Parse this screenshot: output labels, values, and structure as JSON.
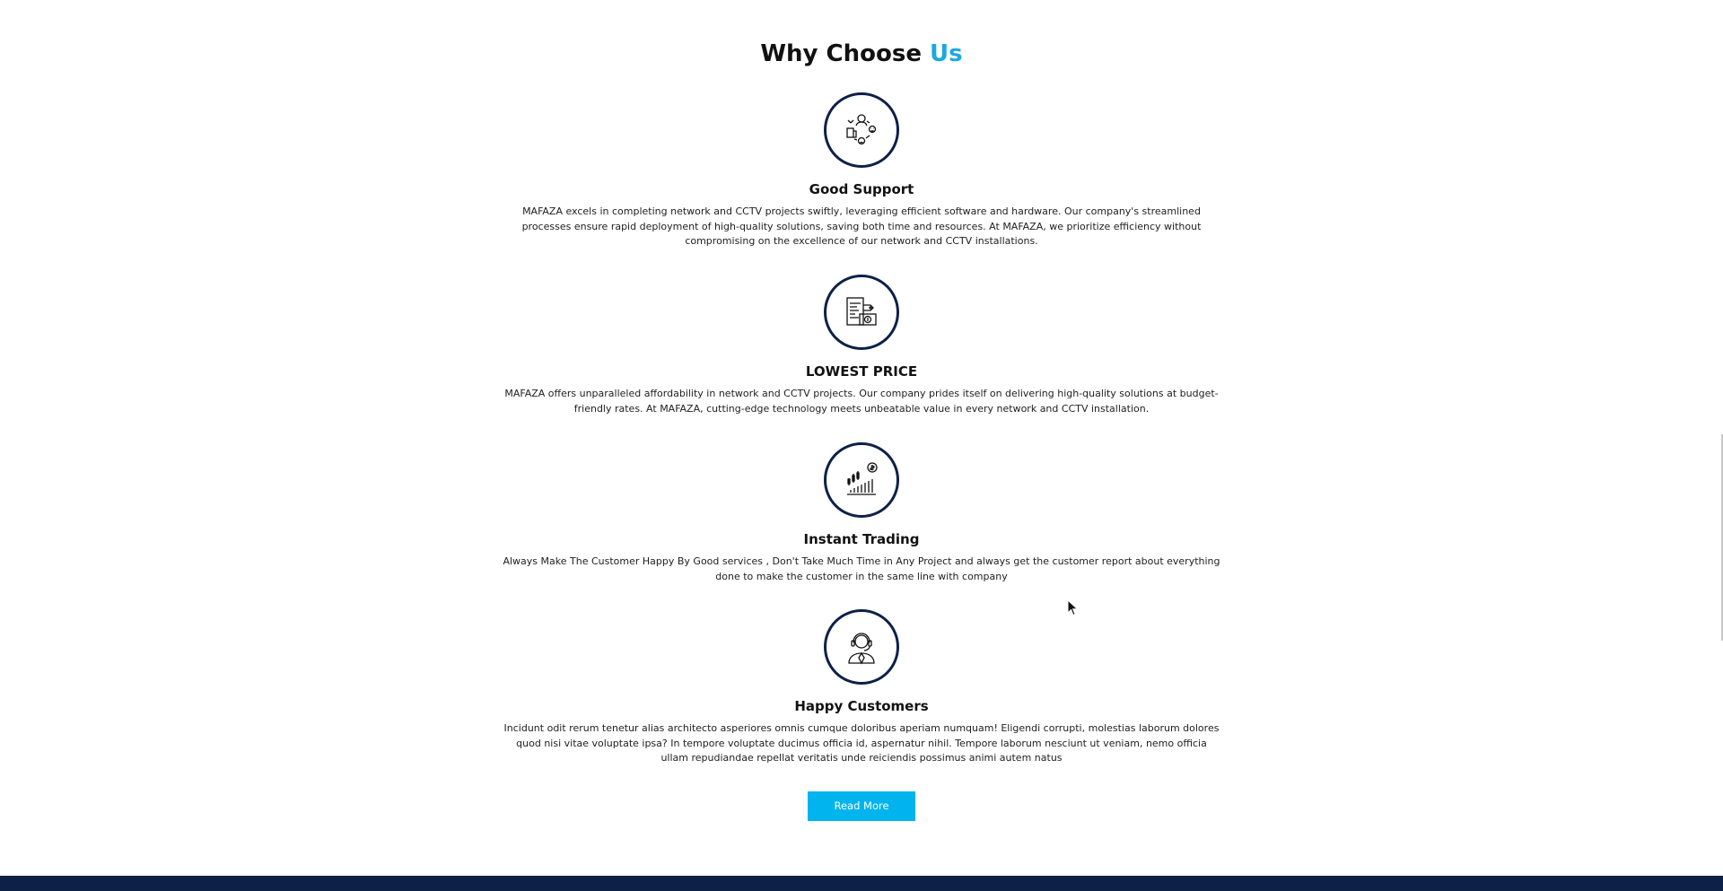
{
  "section": {
    "title_main": "Why Choose",
    "title_accent": "Us"
  },
  "features": [
    {
      "icon": "support-network-icon",
      "title": "Good Support",
      "text": "MAFAZA excels in completing network and CCTV projects swiftly, leveraging efficient software and hardware. Our company's streamlined processes ensure rapid deployment of high-quality solutions, saving both time and resources. At MAFAZA, we prioritize efficiency without compromising on the excellence of our network and CCTV installations."
    },
    {
      "icon": "price-money-icon",
      "title": "LOWEST PRICE",
      "text": "MAFAZA offers unparalleled affordability in network and CCTV projects. Our company prides itself on delivering high-quality solutions at budget-friendly rates. At MAFAZA, cutting-edge technology meets unbeatable value in every network and CCTV installation."
    },
    {
      "icon": "trading-chart-icon",
      "title": "Instant Trading",
      "text": "Always Make The Customer Happy By Good services , Don't Take Much Time in Any Project and always get the customer report about everything done to make the customer in the same line with company"
    },
    {
      "icon": "customer-headset-icon",
      "title": "Happy Customers",
      "text": "Incidunt odit rerum tenetur alias architecto asperiores omnis cumque doloribus aperiam numquam! Eligendi corrupti, molestias laborum dolores quod nisi vitae voluptate ipsa? In tempore voluptate ducimus officia id, aspernatur nihil. Tempore laborum nesciunt ut veniam, nemo officia ullam repudiandae repellat veritatis unde reiciendis possimus animi autem natus"
    }
  ],
  "cta": {
    "read_more_label": "Read More"
  },
  "colors": {
    "accent": "#1aa9e0",
    "button": "#00b4ee",
    "navy": "#0d2147"
  }
}
